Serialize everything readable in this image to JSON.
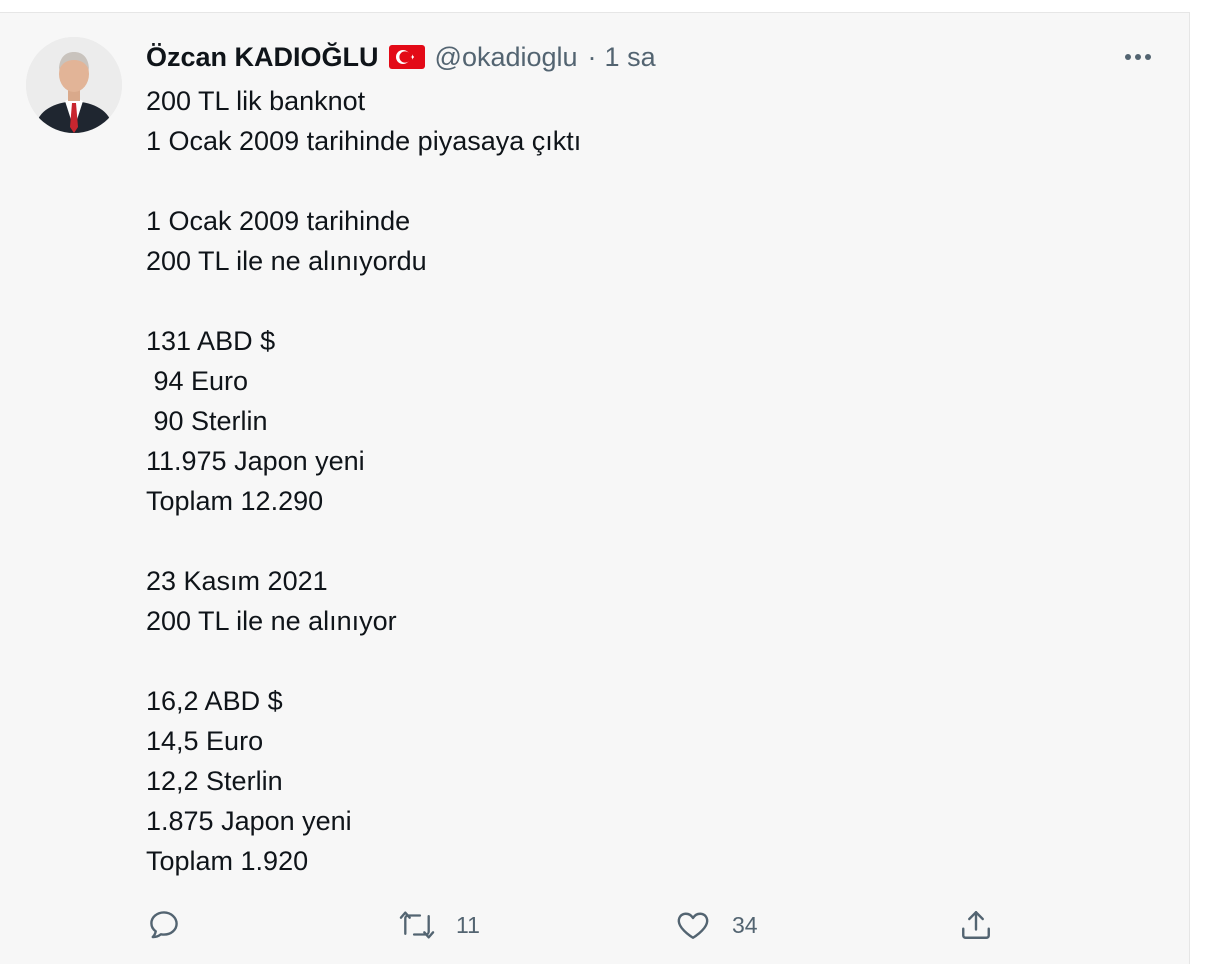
{
  "tweet": {
    "author": {
      "display_name": "Özcan KADIOĞLU",
      "handle": "@okadioglu",
      "separator": "·",
      "time": "1 sa",
      "flag": "turkey-flag-icon"
    },
    "lines": [
      "200 TL lik banknot",
      "1 Ocak 2009 tarihinde piyasaya çıktı",
      "",
      "1 Ocak 2009 tarihinde",
      "200 TL ile ne alınıyordu",
      "",
      "131 ABD $",
      " 94 Euro",
      " 90 Sterlin",
      "11.975 Japon yeni",
      "Toplam 12.290",
      "",
      "23 Kasım 2021",
      "200 TL ile ne alınıyor",
      "",
      "16,2 ABD $",
      "14,5 Euro",
      "12,2 Sterlin",
      "1.875 Japon yeni",
      "Toplam 1.920"
    ],
    "actions": {
      "reply": {
        "icon": "reply-icon",
        "count": ""
      },
      "retweet": {
        "icon": "retweet-icon",
        "count": "11"
      },
      "like": {
        "icon": "heart-icon",
        "count": "34"
      },
      "share": {
        "icon": "share-icon"
      }
    },
    "more_icon": "more-dots-icon"
  },
  "colors": {
    "background": "#f7f7f7",
    "text": "#0f1419",
    "muted": "#536471",
    "flag_red": "#e30a17"
  }
}
